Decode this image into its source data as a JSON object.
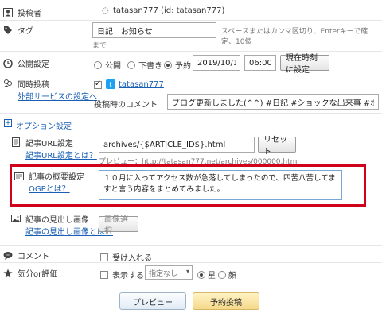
{
  "author": {
    "label": "投稿者",
    "value": "tatasan777 (id: tatasan777)"
  },
  "tags": {
    "label": "タグ",
    "value": "日記　お知らせ",
    "hint_line1": "スペースまたはカンマ区切り、Enterキーで確定、10個",
    "hint_line2": "まで"
  },
  "publish": {
    "label": "公開設定",
    "options": [
      "公開",
      "下書き",
      "予約"
    ],
    "selected": "予約",
    "date": "2019/10/15",
    "time": "06:00",
    "now_button": "現在時刻に設定"
  },
  "sns": {
    "label_line1": "同時投稿",
    "label_line2": "外部サービスの設定へ",
    "twitter_account": "tatasan777",
    "comment_label": "投稿時のコメント",
    "comment_value": "ブログ更新しました(^^) #日記 #ショックな出来事 #ポジティブに捉えて"
  },
  "options_toggle": {
    "icon": "+",
    "label": "オプション設定"
  },
  "url_setting": {
    "label_line1": "記事URL設定",
    "label_line2": "記事URL設定とは？",
    "value": "archives/{$ARTICLE_ID$}.html",
    "reset_button": "リセット",
    "preview": "プレビュー：http://tatasan777.net/archives/000000.html"
  },
  "summary": {
    "label_line1": "記事の概要設定",
    "label_line2": "OGPとは？",
    "value": "１０月に入ってアクセス数が急落してしまったので、四苦八苦してますと言う内容をまとめてみました。"
  },
  "image": {
    "label_line1": "記事の見出し画像",
    "label_line2": "記事の見出し画像とは？",
    "select_button": "画像選択"
  },
  "comment": {
    "label": "コメント",
    "checkbox_label": "受け入れる"
  },
  "mood": {
    "label": "気分or評価",
    "show_label": "表示する",
    "select_value": "指定なし",
    "options": [
      "星",
      "顔"
    ],
    "selected": "星"
  },
  "actions": {
    "preview": "プレビュー",
    "schedule": "予約投稿"
  },
  "colors": {
    "highlight_border": "#d0021b",
    "twitter_blue": "#1da1f2",
    "schedule_button": "#fbe6a2",
    "link": "#1a5fb4"
  }
}
